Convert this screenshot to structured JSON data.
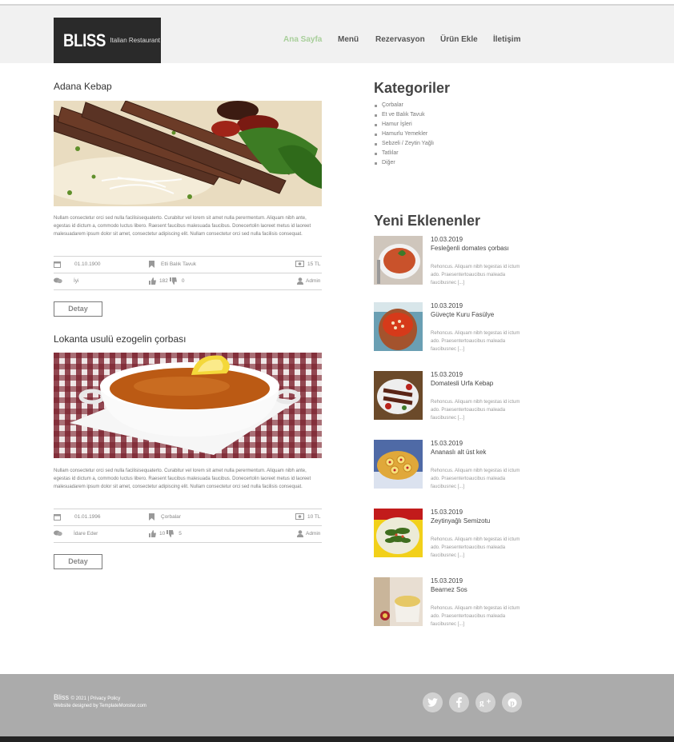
{
  "brand": {
    "name": "BLISS",
    "tagline": "Italian Restaurant"
  },
  "nav": [
    {
      "label": "Ana Sayfa",
      "active": true
    },
    {
      "label": "Menü",
      "active": false
    },
    {
      "label": "Rezervasyon",
      "active": false
    },
    {
      "label": "Ürün Ekle",
      "active": false
    },
    {
      "label": "İletişim",
      "active": false
    }
  ],
  "posts": [
    {
      "title": "Adana Kebap",
      "image": "kebab-photo",
      "text": "Nullam consectetur orci sed nulla facilisisequaterto. Curabitur vel lorem sit amet nulla perermentum. Aliquam nibh ante, egestas id dictum a, commodo luctus libero. Raesent faucibus malesuada faucibus. Donecertolin laoreet metus id laoreet malesuadarem ipsum dolor sit amet, consectetur adipiscing elit. Nullam consectetur orci sed nulla facilisis consequat.",
      "date": "01.10.1900",
      "category": "Etli Balık Tavuk",
      "price": "15 TL",
      "comment": "İyi",
      "likes": "182",
      "dislikes": "0",
      "author": "Admin",
      "button": "Detay"
    },
    {
      "title": "Lokanta usulü ezogelin çorbası",
      "image": "soup-photo",
      "text": "Nullam consectetur orci sed nulla facilisisequaterto. Curabitur vel lorem sit amet nulla perermentum. Aliquam nibh ante, egestas id dictum a, commodo luctus libero. Raesent faucibus malesuada faucibus. Donecertolin laoreet metus id laoreet malesuadarem ipsum dolor sit amet, consectetur adipiscing elit. Nullam consectetur orci sed nulla facilisis consequat.",
      "date": "01.01.1996",
      "category": "Çorbalar",
      "price": "10 TL",
      "comment": "İdare Eder",
      "likes": "10",
      "dislikes": "5",
      "author": "Admin",
      "button": "Detay"
    }
  ],
  "sidebar": {
    "categories_title": "Kategoriler",
    "categories": [
      "Çorbalar",
      "Et ve Balık Tavuk",
      "Hamur İşleri",
      "Hamurlu Yemekler",
      "Sebzeli / Zeytin Yağlı",
      "Tatlılar",
      "Diğer"
    ],
    "recent_title": "Yeni Eklenenler",
    "recent": [
      {
        "date": "10.03.2019",
        "name": "Fesleğenli domates çorbası",
        "desc": "Rehoncus. Aliquam nibh tegestas id ictum ado. Praesentertoaucibus maleada faucibusnec [...]",
        "image": "tomato-soup-thumb"
      },
      {
        "date": "10.03.2019",
        "name": "Güveçte Kuru Fasülye",
        "desc": "Rehoncus. Aliquam nibh tegestas id ictum ado. Praesentertoaucibus maleada faucibusnec [...]",
        "image": "bean-stew-thumb"
      },
      {
        "date": "15.03.2019",
        "name": "Domatesli Urfa Kebap",
        "desc": "Rehoncus. Aliquam nibh tegestas id ictum ado. Praesentertoaucibus maleada faucibusnec [...]",
        "image": "urfa-kebab-thumb"
      },
      {
        "date": "15.03.2019",
        "name": "Ananaslı alt üst kek",
        "desc": "Rehoncus. Aliquam nibh tegestas id ictum ado. Praesentertoaucibus maleada faucibusnec [...]",
        "image": "pineapple-cake-thumb"
      },
      {
        "date": "15.03.2019",
        "name": "Zeytinyağlı Semizotu",
        "desc": "Rehoncus. Aliquam nibh tegestas id ictum ado. Praesentertoaucibus maleada faucibusnec [...]",
        "image": "purslane-thumb"
      },
      {
        "date": "15.03.2019",
        "name": "Bearnez Sos",
        "desc": "Rehoncus. Aliquam nibh tegestas id ictum ado. Praesentertoaucibus maleada faucibusnec [...]",
        "image": "bearnaise-thumb"
      }
    ]
  },
  "footer": {
    "brand": "Bliss",
    "copyright": "© 2021 | Privacy Policy",
    "credit": "Website designed by TemplateMonster.com",
    "social": [
      "twitter-icon",
      "facebook-icon",
      "google-plus-icon",
      "pinterest-icon"
    ]
  },
  "colors": {
    "nav_active": "#a8cf9a",
    "header_bg": "#f1f1f1",
    "footer_bg": "#ababab",
    "logo_bg": "#2a2a2a"
  }
}
